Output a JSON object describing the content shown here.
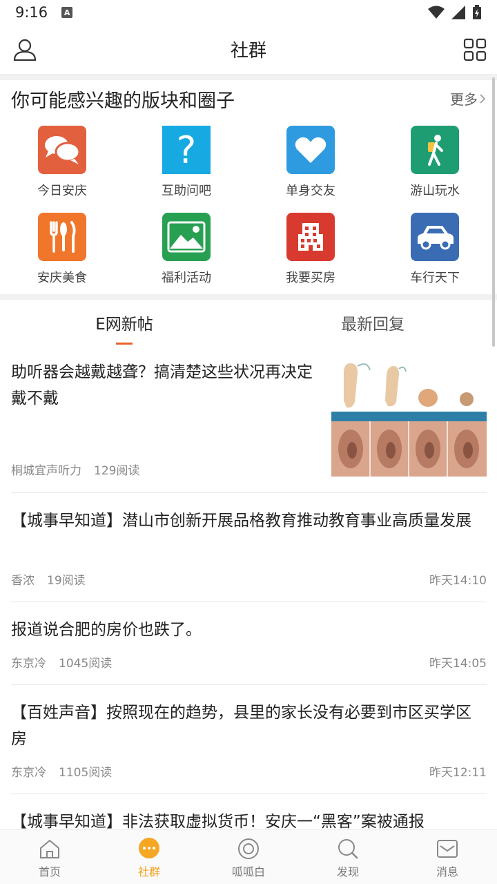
{
  "status": {
    "time": "9:16",
    "notif_letter": "A"
  },
  "header": {
    "title": "社群"
  },
  "interest": {
    "title": "你可能感兴趣的版块和圈子",
    "more": "更多",
    "items": [
      {
        "label": "今日安庆",
        "icon": "chat-bubbles-icon",
        "color": "#e3603f"
      },
      {
        "label": "互助问吧",
        "icon": "question-mark-icon",
        "color": "#17a9e1"
      },
      {
        "label": "单身交友",
        "icon": "heart-icon",
        "color": "#2e9be0"
      },
      {
        "label": "游山玩水",
        "icon": "hiker-icon",
        "color": "#1e9d73"
      },
      {
        "label": "安庆美食",
        "icon": "cutlery-icon",
        "color": "#f0762b"
      },
      {
        "label": "福利活动",
        "icon": "landscape-icon",
        "color": "#27a052"
      },
      {
        "label": "我要买房",
        "icon": "building-icon",
        "color": "#d93a2f"
      },
      {
        "label": "车行天下",
        "icon": "car-icon",
        "color": "#3a6cb4"
      }
    ]
  },
  "tabs": [
    {
      "label": "E网新帖"
    },
    {
      "label": "最新回复"
    }
  ],
  "posts": [
    {
      "title": "助听器会越戴越聋？搞清楚这些状况再决定戴不戴",
      "author": "桐城宜声听力",
      "reads": "129阅读",
      "time": ""
    },
    {
      "title": "【城事早知道】潜山市创新开展品格教育推动教育事业高质量发展",
      "author": "香浓",
      "reads": "19阅读",
      "time": "昨天14:10"
    },
    {
      "title": "报道说合肥的房价也跌了。",
      "author": "东京冷",
      "reads": "1045阅读",
      "time": "昨天14:05"
    },
    {
      "title": "【百姓声音】按照现在的趋势，县里的家长没有必要到市区买学区房",
      "author": "东京冷",
      "reads": "1105阅读",
      "time": "昨天12:11"
    },
    {
      "title": "【城事早知道】非法获取虚拟货币！安庆一“黑客”案被通报",
      "author": "",
      "reads": "",
      "time": ""
    }
  ],
  "tabbar": [
    {
      "label": "首页",
      "icon": "home-icon"
    },
    {
      "label": "社群",
      "icon": "community-icon",
      "active": true
    },
    {
      "label": "呱呱白",
      "icon": "circle-icon"
    },
    {
      "label": "发现",
      "icon": "search-icon"
    },
    {
      "label": "消息",
      "icon": "mail-icon"
    }
  ],
  "colors": {
    "accent": "#e8622a",
    "tabbar_active": "#f39c12"
  }
}
